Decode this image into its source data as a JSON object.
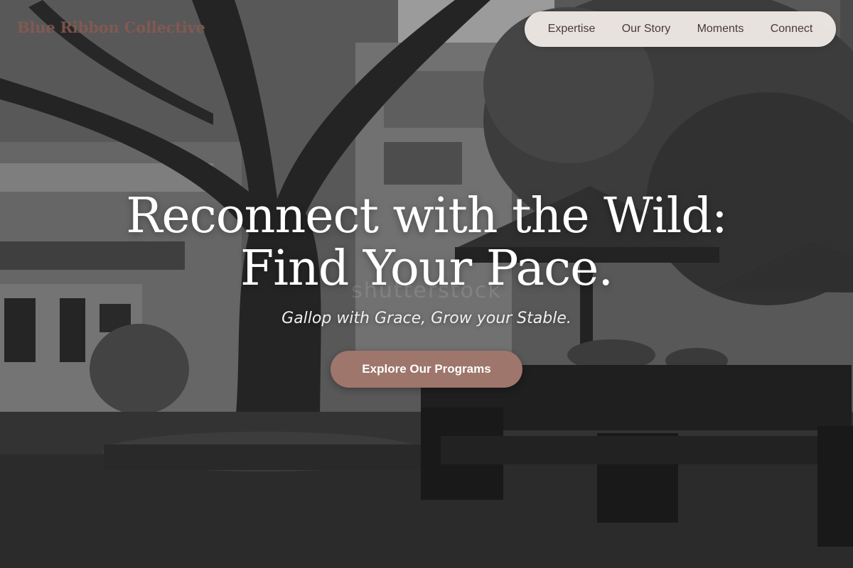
{
  "brand": {
    "name": "Blue Ribbon Collective",
    "color": "#8a5a52"
  },
  "nav": {
    "items": [
      {
        "label": "Expertise"
      },
      {
        "label": "Our Story"
      },
      {
        "label": "Moments"
      },
      {
        "label": "Connect"
      }
    ],
    "background": "#eee9e5"
  },
  "hero": {
    "headline_line1": "Reconnect with the Wild:",
    "headline_line2": "Find Your Pace.",
    "tagline": "Gallop with Grace, Grow your Stable.",
    "cta_label": "Explore Our Programs",
    "cta_color": "#9e766b",
    "background_description_icon": "rainy-courtyard-photo"
  },
  "watermark": {
    "text": "shutterstock"
  }
}
